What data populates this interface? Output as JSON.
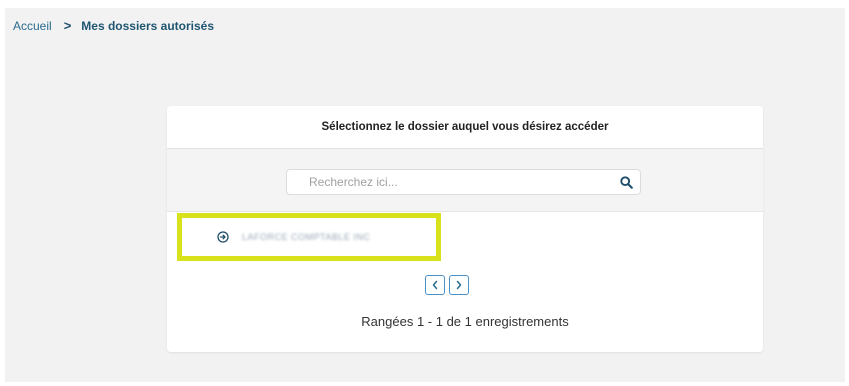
{
  "breadcrumb": {
    "home": "Accueil",
    "separator": ">",
    "current": "Mes dossiers autorisés"
  },
  "card": {
    "title": "Sélectionnez le dossier auquel vous désirez accéder"
  },
  "search": {
    "placeholder": "Recherchez ici...",
    "value": "",
    "icon": "search-icon"
  },
  "folders": [
    {
      "name": "LAFORCE COMPTABLE INC",
      "icon": "arrow-circle-right-icon"
    }
  ],
  "pagination": {
    "prev_icon": "chevron-left-icon",
    "next_icon": "chevron-right-icon",
    "summary": "Rangées 1 - 1 de 1 enregistrements"
  },
  "colors": {
    "highlight": "#d8e21a",
    "link": "#2a6a8e",
    "pager_border": "#4a90c4"
  }
}
